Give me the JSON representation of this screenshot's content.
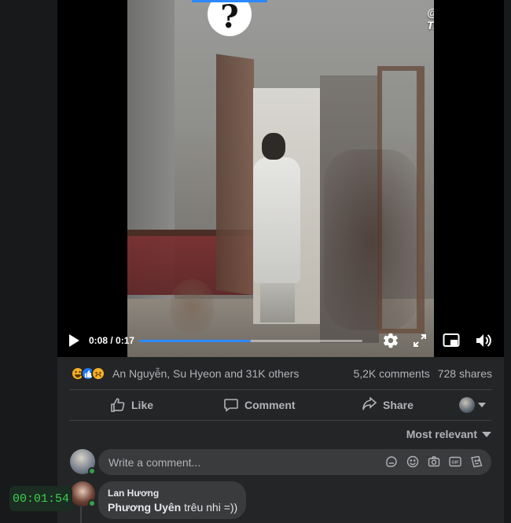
{
  "video": {
    "logo_glyph": "?",
    "watermark": "@Bin Tran",
    "time": "0:08 / 0:17",
    "progress_fraction": 0.5,
    "icons": [
      "play-icon",
      "gear-icon",
      "fullscreen-icon",
      "picture-in-picture-icon",
      "volume-icon"
    ]
  },
  "reactions": {
    "icons": [
      "haha-icon",
      "like-icon",
      "sad-icon"
    ],
    "names": "An Nguyễn, Su Hyeon and 31K others",
    "comments": "5,2K comments",
    "shares": "728 shares"
  },
  "actions": {
    "like": "Like",
    "comment": "Comment",
    "share": "Share"
  },
  "sort": {
    "label": "Most relevant"
  },
  "composer": {
    "placeholder": "Write a comment...",
    "icons": [
      "sticker-icon",
      "emoji-icon",
      "camera-icon",
      "gif-icon",
      "avatar-sticker-icon"
    ]
  },
  "comment": {
    "author": "Lan Hương",
    "mention": "Phương Uyên",
    "text": " trêu nhi =))"
  },
  "timer": {
    "value": "00:01:54"
  },
  "colors": {
    "background": "#18191a",
    "card": "#242526",
    "accent": "#2d88ff",
    "online": "#31a24c",
    "timer_text": "#3ccf4e"
  }
}
